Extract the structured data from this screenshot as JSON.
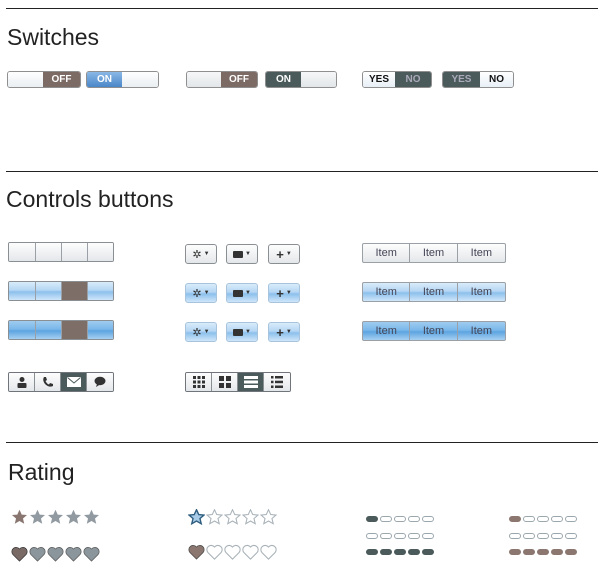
{
  "sections": {
    "switches": "Switches",
    "controls": "Controls buttons",
    "rating": "Rating"
  },
  "switches": {
    "off": "OFF",
    "on": "ON",
    "yes": "YES",
    "no": "NO"
  },
  "item_buttons": {
    "labels": [
      "Item",
      "Item",
      "Item"
    ]
  },
  "colors": {
    "brown": "#7c6a64",
    "dark_teal": "#4b5a5a",
    "blue": "#4a86c8",
    "light_blue": "#b5d6f3"
  },
  "ratings": {
    "stars_brown_filled": 1,
    "stars_blue_filled": 1,
    "hearts_brown_filled": 1,
    "hearts_outline_filled": 1,
    "total": 5
  }
}
